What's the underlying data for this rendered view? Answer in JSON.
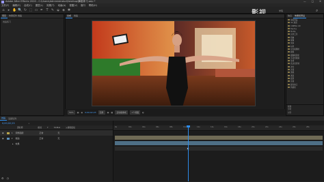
{
  "app": {
    "title": "Adobe After Effects 2020 - C:\\Users\\Administrator\\Desktop\\舞蹈练习.aep *",
    "window_controls": [
      "—",
      "□",
      "✕"
    ]
  },
  "menu": {
    "items": [
      "文件(F)",
      "编辑(E)",
      "合成(C)",
      "图层(L)",
      "效果(T)",
      "动画(A)",
      "视图(V)",
      "窗口",
      "帮助(H)"
    ]
  },
  "toolbar": {
    "tools": [
      "⌂",
      "▸",
      "✋",
      "🔍",
      "↻",
      "⬚",
      "▭",
      "✒",
      "T",
      "✎",
      "⬙",
      "◈",
      "✱"
    ],
    "brand": "影视",
    "brand_sub": "学院",
    "search_icon": "⌕"
  },
  "left_panel": {
    "tabs": [
      "项目",
      "效果控件 舞蹈"
    ],
    "project_label": "舞蹈练习"
  },
  "comp_panel": {
    "tabs": [
      "合成",
      "舞蹈"
    ],
    "controls": {
      "zoom": "50%",
      "timecode": "0;00;02;23",
      "resolution": "完整",
      "camera": "活动摄像机",
      "views": "1个视图"
    }
  },
  "right_panel": {
    "tabs": [
      "信息",
      "效果和预设"
    ],
    "items": [
      "动画预设",
      "3D 通道",
      "CINEMA 4D",
      "Keying",
      "Matte",
      "实用工具",
      "扭曲",
      "抠像",
      "文本",
      "时间",
      "杂色和颗粒",
      "模拟",
      "模糊和锐化",
      "沉浸式视频",
      "生成",
      "表达式控制",
      "过时",
      "过渡",
      "透视",
      "通道",
      "遮罩",
      "音频",
      "颜色校正",
      "风格化"
    ],
    "bottom_items": [
      "段落",
      "字符",
      "对齐"
    ]
  },
  "timeline": {
    "tabs": [
      "舞蹈",
      "渲染队列"
    ],
    "timecode": "0;00;02;23",
    "columns": [
      "源名称",
      "模式",
      "T",
      "TrkMat",
      "父级和链接"
    ],
    "layers": [
      {
        "num": "1",
        "name": "调整图层",
        "mode": "正常",
        "parent": "无",
        "color": "#b8a44a"
      },
      {
        "num": "2",
        "name": "舞蹈",
        "mode": "正常",
        "parent": "无",
        "color": "#5b8fb8"
      },
      {
        "num": "",
        "name": "效果",
        "mode": "",
        "parent": "",
        "color": "#444444"
      }
    ],
    "ruler_labels": [
      "0s",
      "02s",
      "04s",
      "06s",
      "08s",
      "10s",
      "12s",
      "14s",
      "16s",
      "18s",
      "20s",
      "22s",
      "24s",
      "26s",
      "28s"
    ]
  }
}
